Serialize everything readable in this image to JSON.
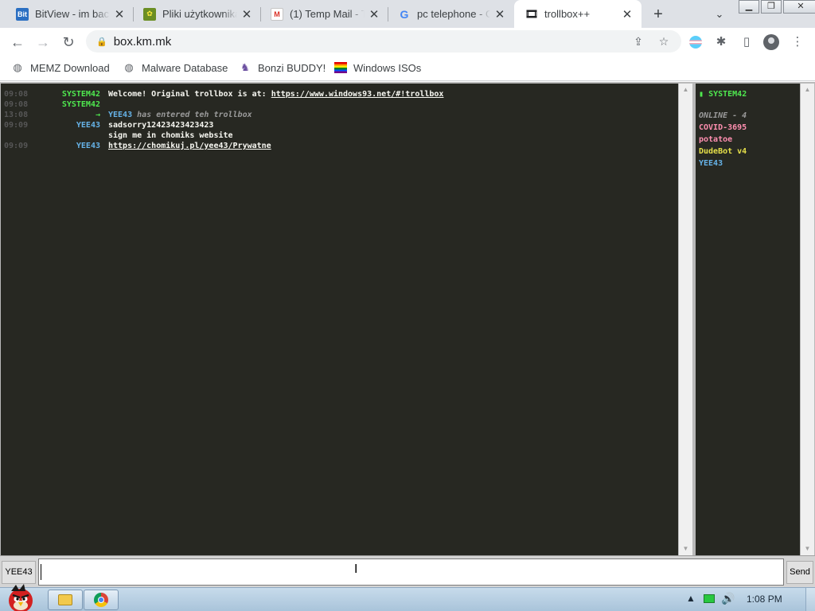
{
  "browser": {
    "tabs": [
      {
        "title": "BitView - im bac",
        "favicon": "bitview-icon"
      },
      {
        "title": "Pliki użytkownika",
        "favicon": "chomikuj-icon"
      },
      {
        "title": "(1) Temp Mail - T",
        "favicon": "gmail-icon"
      },
      {
        "title": "pc telephone - G",
        "favicon": "google-icon"
      },
      {
        "title": "trollbox++",
        "favicon": "film-icon"
      }
    ],
    "url": "box.km.mk",
    "bookmarks": [
      {
        "label": "MEMZ Download",
        "icon": "globe-icon"
      },
      {
        "label": "Malware Database",
        "icon": "globe-icon"
      },
      {
        "label": "Bonzi BUDDY!",
        "icon": "bonzi-icon"
      },
      {
        "label": "Windows ISOs",
        "icon": "rainbow-flag-icon"
      }
    ]
  },
  "trollbox": {
    "messages": [
      {
        "time": "09:08",
        "nick": "SYSTEM42",
        "nick_color": "#4fe84f",
        "text": "Welcome! Original trollbox is at: ",
        "link": "https://www.windows93.net/#!trollbox"
      },
      {
        "time": "09:08",
        "nick": "SYSTEM42",
        "nick_color": "#4fe84f",
        "text": ""
      },
      {
        "time": "13:08",
        "nick": "→",
        "nick_color": "#4fe84f",
        "sys_nick": "YEE43",
        "sys_text": " has entered teh trollbox"
      },
      {
        "time": "09:09",
        "nick": "YEE43",
        "nick_color": "#66b3e8",
        "text": "sadsorry12423423423423"
      },
      {
        "time": "",
        "nick": "",
        "nick_color": "#66b3e8",
        "text": "sign me in chomiks website"
      },
      {
        "time": "09:09",
        "nick": "YEE43",
        "nick_color": "#66b3e8",
        "link": "https://chomikuj.pl/yee43/Prywatne"
      }
    ],
    "userlist": [
      {
        "name": "SYSTEM42",
        "color": "#4fe84f",
        "marker": "▮"
      },
      {
        "name": "",
        "color": "#ffffff"
      },
      {
        "name": "ONLINE - 4",
        "color": "#9a9a9a"
      },
      {
        "name": "COVID-3695",
        "color": "#ff8fb0"
      },
      {
        "name": "potatoe",
        "color": "#ff8fb0"
      },
      {
        "name": "DudeBot v4",
        "color": "#e6e04a"
      },
      {
        "name": "YEE43",
        "color": "#66b3e8"
      }
    ],
    "nick_box": "YEE43",
    "input_value": "",
    "send_label": "Send"
  },
  "taskbar": {
    "clock": "1:08 PM"
  },
  "colors": {
    "chat_bg": "#272822",
    "accent_green": "#4fe84f",
    "accent_blue": "#66b3e8"
  }
}
